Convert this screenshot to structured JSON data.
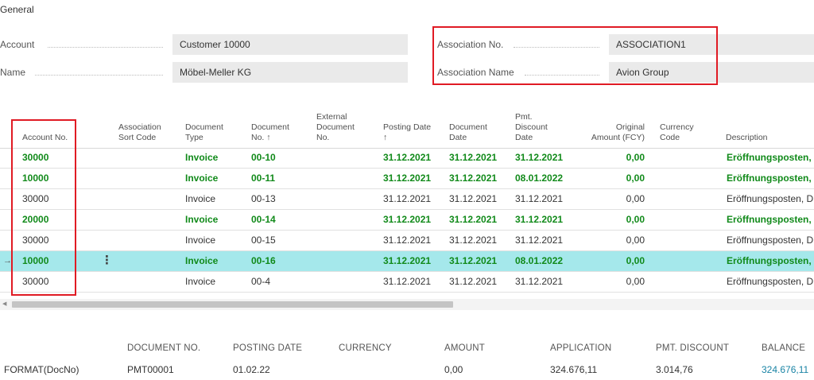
{
  "general": {
    "section_title": "General",
    "account": {
      "label": "Account",
      "value": "Customer 10000"
    },
    "name": {
      "label": "Name",
      "value": "Möbel-Meller KG"
    },
    "association_no": {
      "label": "Association No.",
      "value": "ASSOCIATION1"
    },
    "association_name": {
      "label": "Association Name",
      "value": "Avion Group"
    }
  },
  "grid": {
    "headers": [
      "Account No.",
      "Association\nSort Code",
      "Document\nType",
      "Document\nNo. ↑",
      "External\nDocument\nNo.",
      "Posting Date\n↑",
      "Document\nDate",
      "Pmt.\nDiscount\nDate",
      "Original\nAmount (FCY)",
      "Currency\nCode",
      "Description"
    ],
    "rows": [
      {
        "account_no": "30000",
        "sort_code": "",
        "doc_type": "Invoice",
        "doc_no": "00-10",
        "ext_doc_no": "",
        "posting_date": "31.12.2021",
        "doc_date": "31.12.2021",
        "pmt_disc_date": "31.12.2021",
        "amount_fcy": "0,00",
        "currency": "",
        "description": "Eröffnungsposten, D",
        "bold": true,
        "selected": false
      },
      {
        "account_no": "10000",
        "sort_code": "",
        "doc_type": "Invoice",
        "doc_no": "00-11",
        "ext_doc_no": "",
        "posting_date": "31.12.2021",
        "doc_date": "31.12.2021",
        "pmt_disc_date": "08.01.2022",
        "amount_fcy": "0,00",
        "currency": "",
        "description": "Eröffnungsposten, D",
        "bold": true,
        "selected": false
      },
      {
        "account_no": "30000",
        "sort_code": "",
        "doc_type": "Invoice",
        "doc_no": "00-13",
        "ext_doc_no": "",
        "posting_date": "31.12.2021",
        "doc_date": "31.12.2021",
        "pmt_disc_date": "31.12.2021",
        "amount_fcy": "0,00",
        "currency": "",
        "description": "Eröffnungsposten, D",
        "bold": false,
        "selected": false
      },
      {
        "account_no": "20000",
        "sort_code": "",
        "doc_type": "Invoice",
        "doc_no": "00-14",
        "ext_doc_no": "",
        "posting_date": "31.12.2021",
        "doc_date": "31.12.2021",
        "pmt_disc_date": "31.12.2021",
        "amount_fcy": "0,00",
        "currency": "",
        "description": "Eröffnungsposten, D",
        "bold": true,
        "selected": false
      },
      {
        "account_no": "30000",
        "sort_code": "",
        "doc_type": "Invoice",
        "doc_no": "00-15",
        "ext_doc_no": "",
        "posting_date": "31.12.2021",
        "doc_date": "31.12.2021",
        "pmt_disc_date": "31.12.2021",
        "amount_fcy": "0,00",
        "currency": "",
        "description": "Eröffnungsposten, D",
        "bold": false,
        "selected": false
      },
      {
        "account_no": "10000",
        "sort_code": "",
        "doc_type": "Invoice",
        "doc_no": "00-16",
        "ext_doc_no": "",
        "posting_date": "31.12.2021",
        "doc_date": "31.12.2021",
        "pmt_disc_date": "08.01.2022",
        "amount_fcy": "0,00",
        "currency": "",
        "description": "Eröffnungsposten, D",
        "bold": true,
        "selected": true
      },
      {
        "account_no": "30000",
        "sort_code": "",
        "doc_type": "Invoice",
        "doc_no": "00-4",
        "ext_doc_no": "",
        "posting_date": "31.12.2021",
        "doc_date": "31.12.2021",
        "pmt_disc_date": "31.12.2021",
        "amount_fcy": "0,00",
        "currency": "",
        "description": "Eröffnungsposten, D",
        "bold": false,
        "selected": false
      }
    ],
    "row_marker": "→",
    "row_menu": "⋮"
  },
  "summary": {
    "label": "FORMAT(DocNo)",
    "headers": [
      "DOCUMENT NO.",
      "POSTING DATE",
      "CURRENCY",
      "AMOUNT",
      "APPLICATION",
      "PMT. DISCOUNT",
      "BALANCE"
    ],
    "values": [
      "PMT00001",
      "01.02.22",
      "",
      "0,00",
      "324.676,11",
      "3.014,76",
      "324.676,11"
    ]
  },
  "colors": {
    "bold_row_text": "#118a1a",
    "selected_row": "#a5e8eb",
    "highlight_frame": "#e01b24",
    "balance_link": "#1a84a5"
  }
}
